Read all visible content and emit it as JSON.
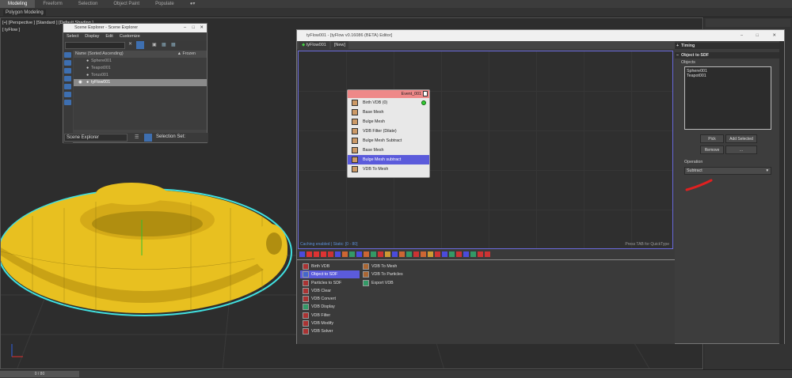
{
  "ribbon": {
    "tabs": [
      "Modeling",
      "Freeform",
      "Selection",
      "Object Paint",
      "Populate"
    ]
  },
  "subribbon": {
    "label": "Polygon Modeling"
  },
  "viewport": {
    "label1": "[+] [Perspective ] [Standard ] [Default Shading ]",
    "label2": "[ tyFlow ]"
  },
  "timeline": {
    "frame": "0 / 80"
  },
  "scene_explorer": {
    "title": "Scene Explorer - Scene Explorer",
    "menu": [
      "Select",
      "Display",
      "Edit",
      "Customize"
    ],
    "col_name": "Name (Sorted Ascending)",
    "col_frozen": "▲ Frozen",
    "items": [
      "Sphere001",
      "Teapot001",
      "Torus001",
      "tyFlow001"
    ],
    "footer_dropdown": "Scene Explorer",
    "footer_label": "Selection Set:"
  },
  "tyflow": {
    "title": "tyFlow001 - [tyFlow v0.16086 (BETA) Editor]",
    "tabs": [
      "tyFlow001",
      "[New]"
    ],
    "event": {
      "name": "Event_001",
      "operators": [
        "Birth VDB (0)",
        "Base Mesh",
        "Bulge Mesh",
        "VDB Filter (Dilate)",
        "Bulge Mesh Subtract",
        "Base Mesh",
        "Bulge Mesh subtract",
        "VDB To Mesh"
      ]
    },
    "status_left": "Caching enabled | Static: [0 - 80]",
    "status_right": "Press TAB for QuickType",
    "depot_col1": [
      "Birth VDB",
      "Object to SDF",
      "Particles to SDF",
      "VDB Clear",
      "VDB Convert",
      "VDB Display",
      "VDB Filter",
      "VDB Modify",
      "VDB Solver"
    ],
    "depot_col2": [
      "VDB To Mesh",
      "VDB To Particles",
      "Export VDB"
    ],
    "params": {
      "timing": "Timing",
      "rollout": "Object to SDF",
      "objects_label": "Objects",
      "objects": [
        "Sphere001",
        "Teapot001"
      ],
      "pick": "Pick",
      "add_selected": "Add Selected",
      "remove": "Remove",
      "dots": "...",
      "operation_label": "Operation",
      "operation_value": "Subtract"
    }
  },
  "colors": {
    "accent": "#5b5bdb",
    "event_header": "#ee8888",
    "torus": "#e8c020",
    "selection_outline": "#40e0e0",
    "annotation": "#e02020"
  }
}
